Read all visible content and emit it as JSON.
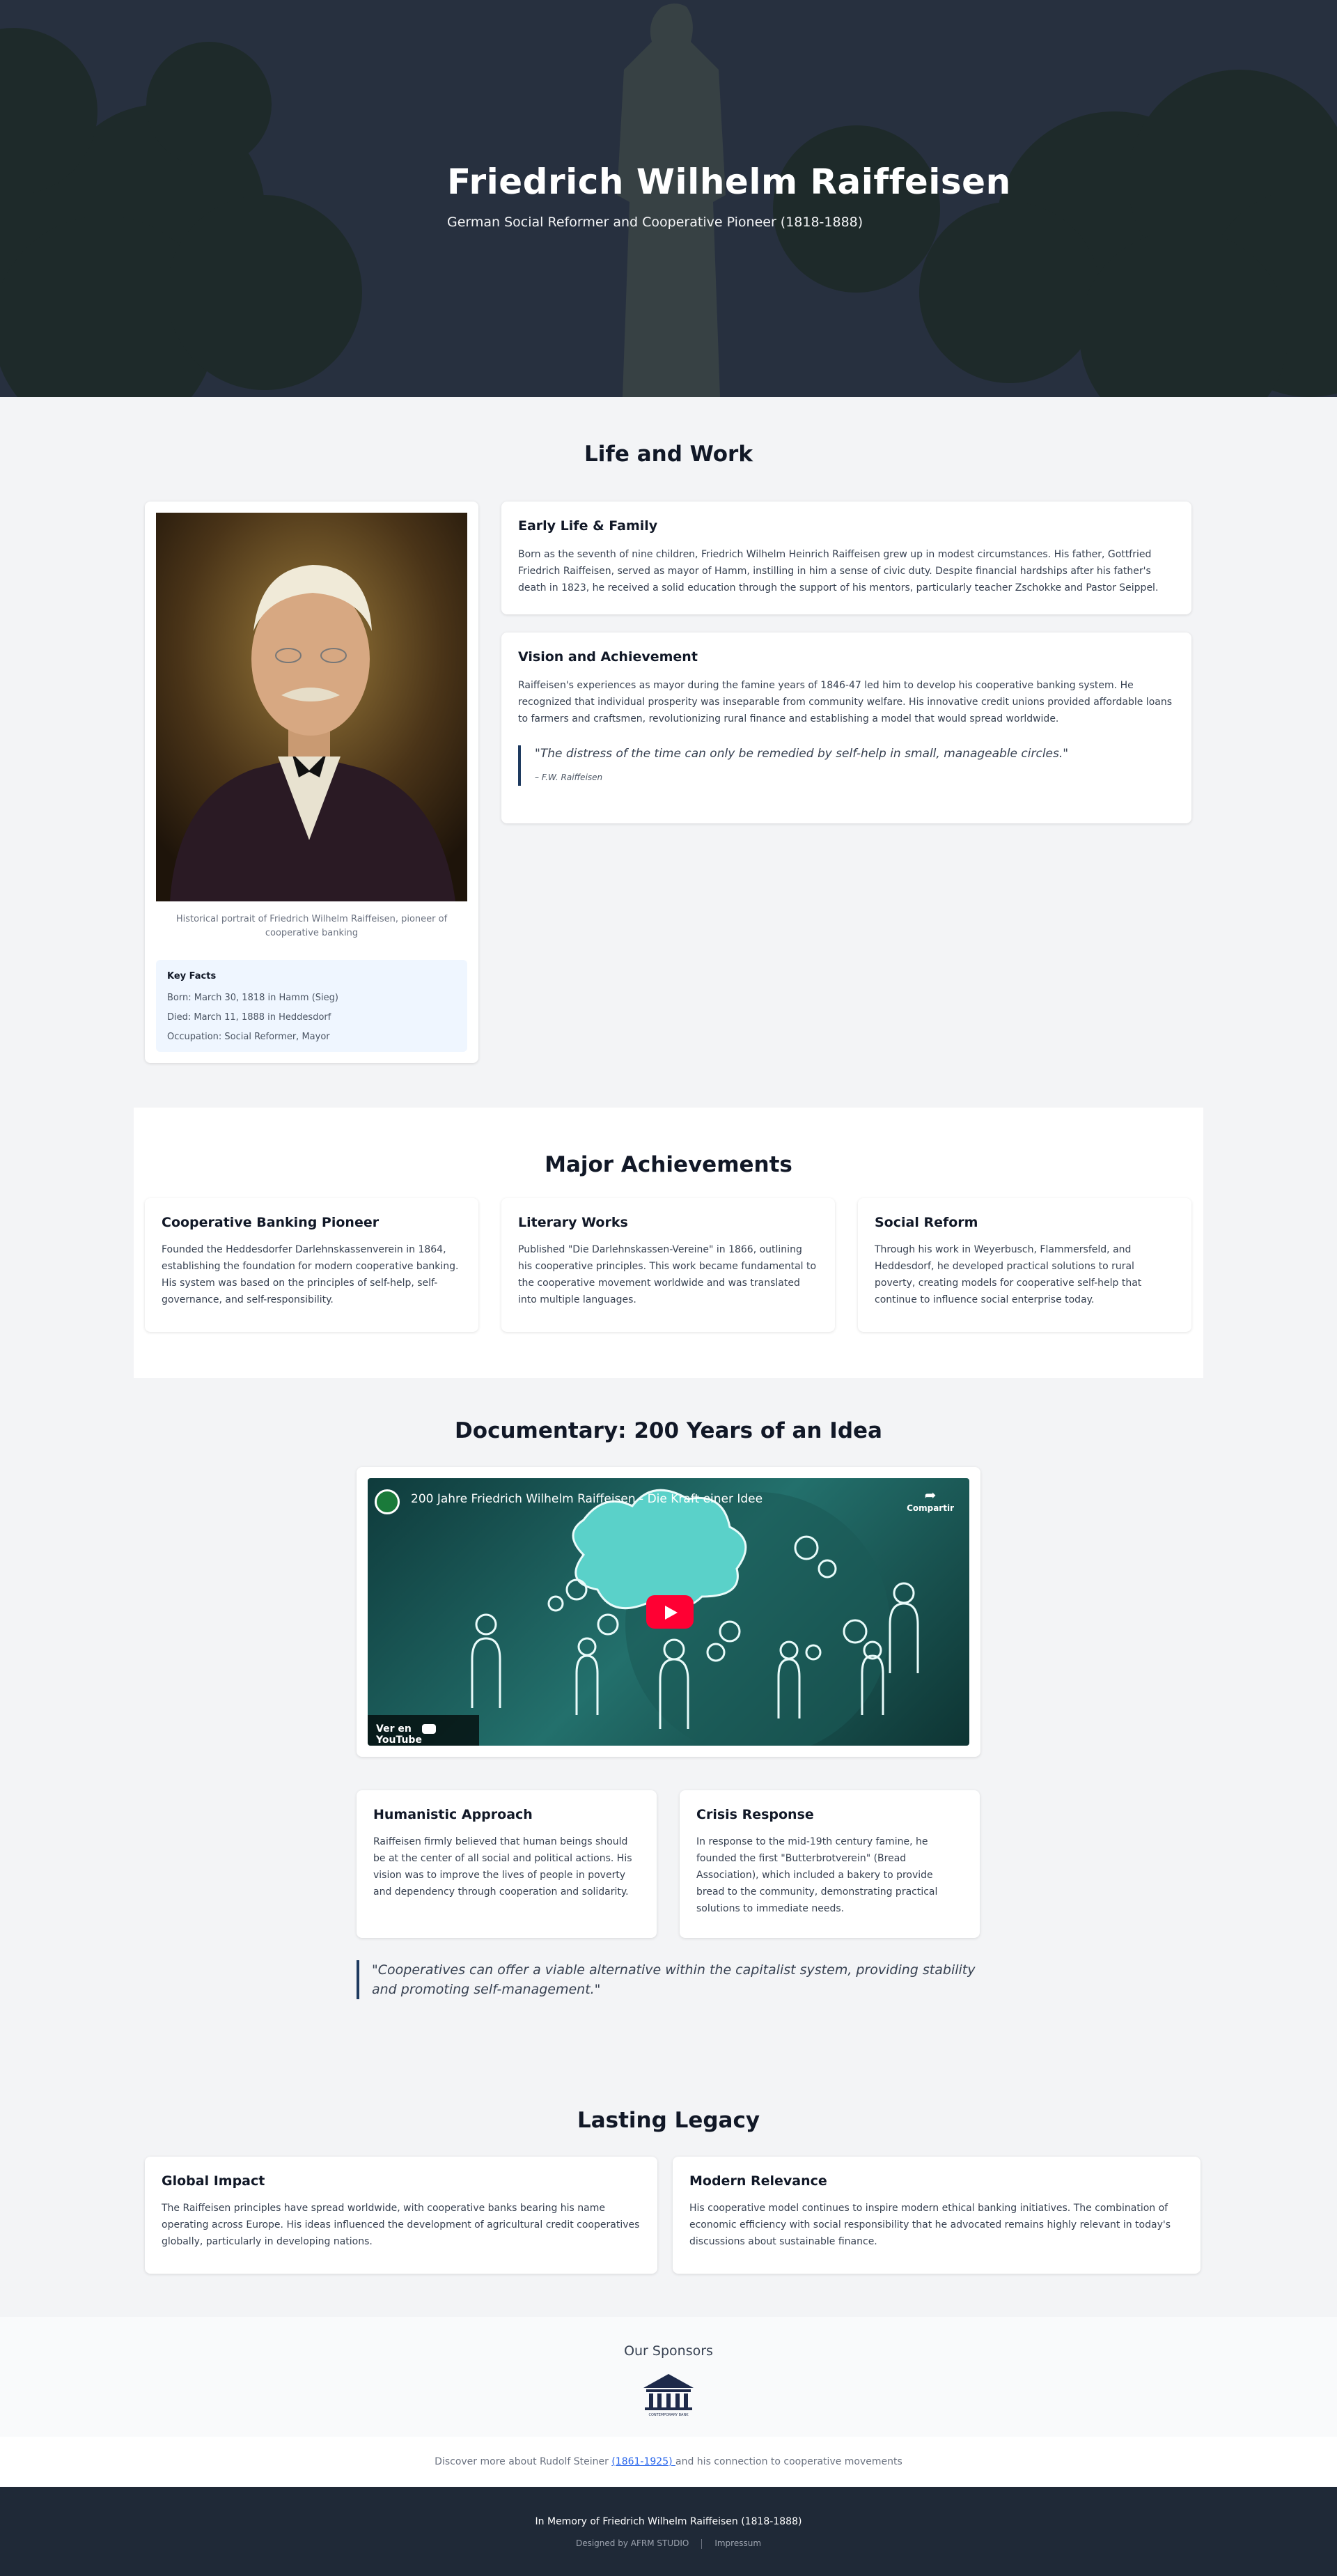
{
  "hero": {
    "title": "Friedrich Wilhelm Raiffeisen",
    "subtitle": "German Social Reformer and Cooperative Pioneer (1818-1888)"
  },
  "life": {
    "title": "Life and Work",
    "portrait_caption": "Historical portrait of Friedrich Wilhelm Raiffeisen, pioneer of cooperative banking",
    "key_facts": {
      "heading": "Key Facts",
      "born": "Born: March 30, 1818 in Hamm (Sieg)",
      "died": "Died: March 11, 1888 in Heddesdorf",
      "occupation": "Occupation: Social Reformer, Mayor"
    },
    "early": {
      "heading": "Early Life & Family",
      "text": "Born as the seventh of nine children, Friedrich Wilhelm Heinrich Raiffeisen grew up in modest circumstances. His father, Gottfried Friedrich Raiffeisen, served as mayor of Hamm, instilling in him a sense of civic duty. Despite financial hardships after his father's death in 1823, he received a solid education through the support of his mentors, particularly teacher Zschokke and Pastor Seippel."
    },
    "vision": {
      "heading": "Vision and Achievement",
      "text": "Raiffeisen's experiences as mayor during the famine years of 1846-47 led him to develop his cooperative banking system. He recognized that individual prosperity was inseparable from community welfare. His innovative credit unions provided affordable loans to farmers and craftsmen, revolutionizing rural finance and establishing a model that would spread worldwide.",
      "quote": "\"The distress of the time can only be remedied by self-help in small, manageable circles.\"",
      "quote_author": "– F.W. Raiffeisen"
    }
  },
  "achievements": {
    "title": "Major Achievements",
    "items": [
      {
        "heading": "Cooperative Banking Pioneer",
        "text": "Founded the Heddesdorfer Darlehnskassenverein in 1864, establishing the foundation for modern cooperative banking. His system was based on the principles of self-help, self-governance, and self-responsibility."
      },
      {
        "heading": "Literary Works",
        "text": "Published \"Die Darlehnskassen-Vereine\" in 1866, outlining his cooperative principles. This work became fundamental to the cooperative movement worldwide and was translated into multiple languages."
      },
      {
        "heading": "Social Reform",
        "text": "Through his work in Weyerbusch, Flammersfeld, and Heddesdorf, he developed practical solutions to rural poverty, creating models for cooperative self-help that continue to influence social enterprise today."
      }
    ]
  },
  "documentary": {
    "title": "Documentary: 200 Years of an Idea",
    "video_title": "200 Jahre Friedrich Wilhelm Raiffeisen - Die Kraft einer Idee",
    "share_label": "Compartir",
    "watch_on": "Ver en",
    "youtube_label": "YouTube",
    "cards": [
      {
        "heading": "Humanistic Approach",
        "text": "Raiffeisen firmly believed that human beings should be at the center of all social and political actions. His vision was to improve the lives of people in poverty and dependency through cooperation and solidarity."
      },
      {
        "heading": "Crisis Response",
        "text": "In response to the mid-19th century famine, he founded the first \"Butterbrotverein\" (Bread Association), which included a bakery to provide bread to the community, demonstrating practical solutions to immediate needs."
      }
    ],
    "quote": "\"Cooperatives can offer a viable alternative within the capitalist system, providing stability and promoting self-management.\""
  },
  "legacy": {
    "title": "Lasting Legacy",
    "items": [
      {
        "heading": "Global Impact",
        "text": "The Raiffeisen principles have spread worldwide, with cooperative banks bearing his name operating across Europe. His ideas influenced the development of agricultural credit cooperatives globally, particularly in developing nations."
      },
      {
        "heading": "Modern Relevance",
        "text": "His cooperative model continues to inspire modern ethical banking initiatives. The combination of economic efficiency with social responsibility that he advocated remains highly relevant in today's discussions about sustainable finance."
      }
    ]
  },
  "sponsors": {
    "title": "Our Sponsors",
    "logo_text": "CONTEMPORARY BANK"
  },
  "discover": {
    "prefix": "Discover more about Rudolf Steiner ",
    "link": "(1861-1925) ",
    "suffix": "and his connection to cooperative movements"
  },
  "footer": {
    "memorial": "In Memory of Friedrich Wilhelm Raiffeisen (1818-1888)",
    "designed_by": "Designed by AFRM STUDIO",
    "impressum": "Impressum"
  },
  "colors": {
    "accent": "#1e3a5f",
    "footer_bg": "#1f2937",
    "link": "#2563eb"
  }
}
